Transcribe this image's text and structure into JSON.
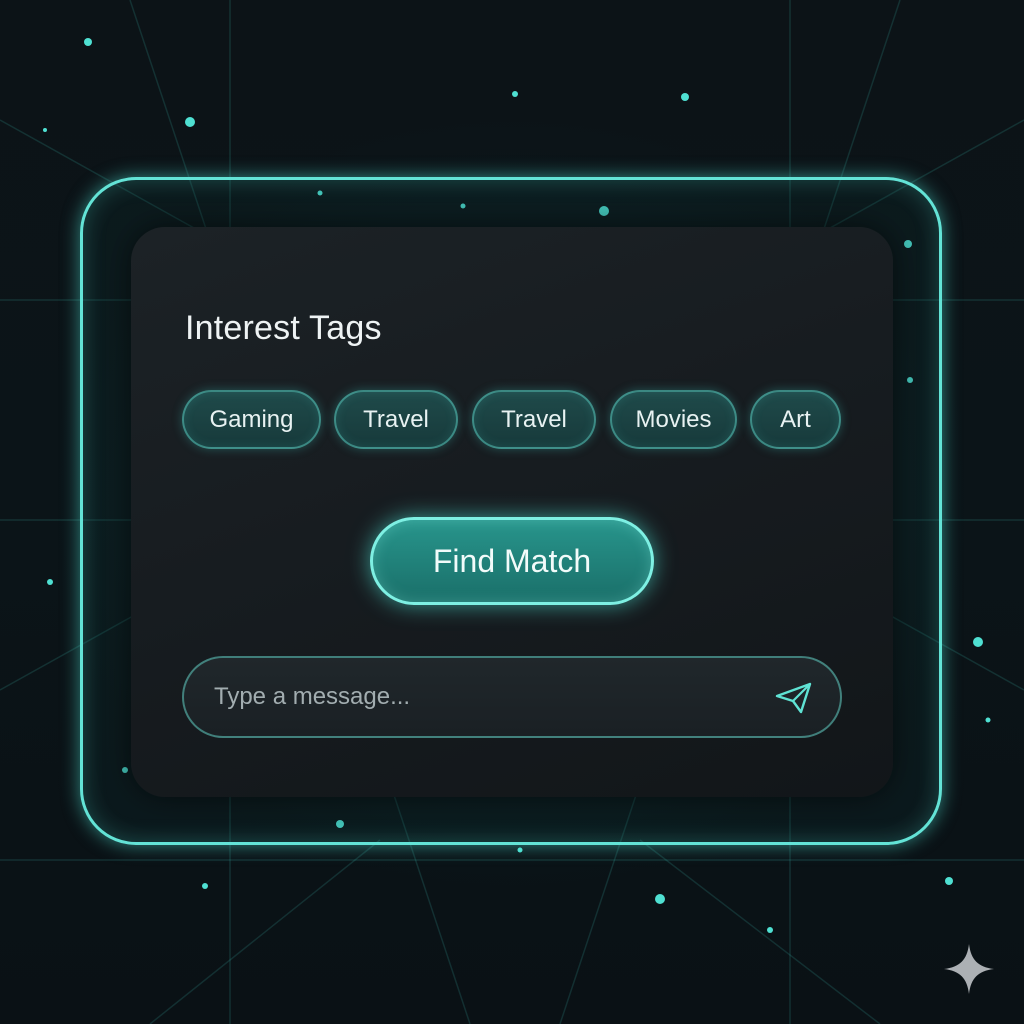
{
  "card": {
    "title": "Interest Tags"
  },
  "tags": [
    {
      "label": "Gaming"
    },
    {
      "label": "Travel"
    },
    {
      "label": "Travel"
    },
    {
      "label": "Movies"
    },
    {
      "label": "Art"
    }
  ],
  "actions": {
    "find_match_label": "Find Match"
  },
  "message": {
    "placeholder": "Type a message...",
    "value": "",
    "send_icon": "send-icon"
  },
  "colors": {
    "accent": "#63e3d6",
    "button_fill": "#1f8179",
    "panel": "#171c20",
    "background": "#0b1114"
  }
}
